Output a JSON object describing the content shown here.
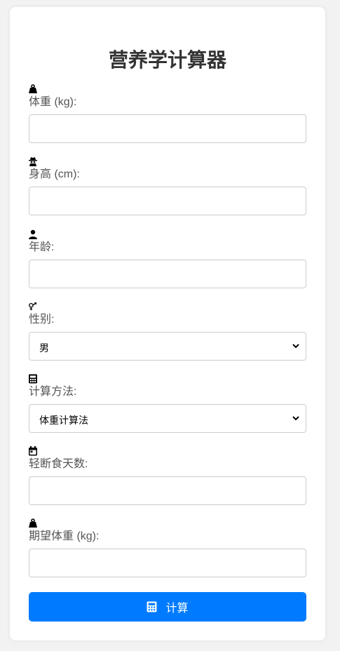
{
  "title": "营养学计算器",
  "fields": {
    "weight": {
      "label": "体重 (kg):",
      "icon": "weight-icon",
      "value": ""
    },
    "height": {
      "label": "身高 (cm):",
      "icon": "user-secret-icon",
      "value": ""
    },
    "age": {
      "label": "年龄:",
      "icon": "user-icon",
      "value": ""
    },
    "gender": {
      "label": "性别:",
      "icon": "gender-icon",
      "selected": "男"
    },
    "method": {
      "label": "计算方法:",
      "icon": "calculator-icon",
      "selected": "体重计算法"
    },
    "fasting_days": {
      "label": "轻断食天数:",
      "icon": "calendar-icon",
      "value": ""
    },
    "target_weight": {
      "label": "期望体重 (kg):",
      "icon": "weight-icon",
      "value": ""
    }
  },
  "button": {
    "label": "计算",
    "icon": "calculator-icon",
    "color": "#007bff"
  }
}
